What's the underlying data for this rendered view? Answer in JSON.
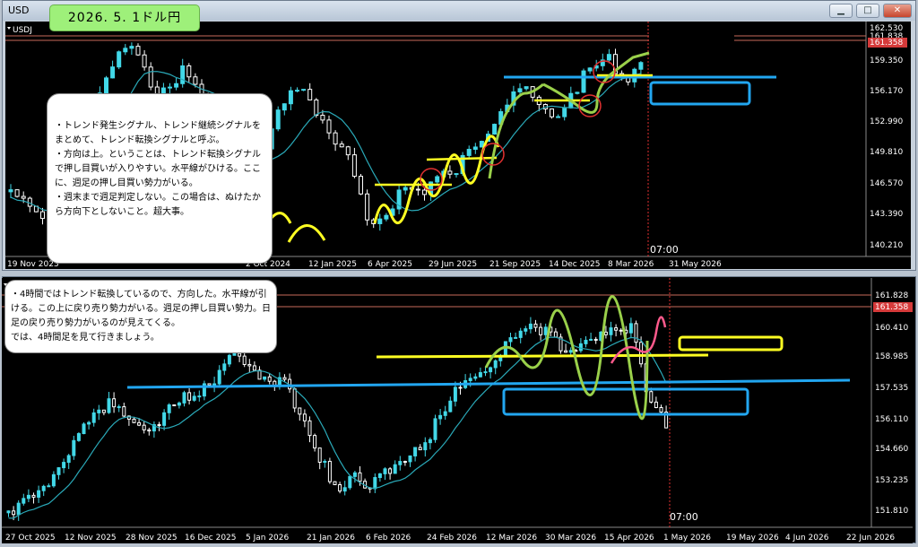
{
  "banner": "2026. 5. 1ドル円",
  "window1": {
    "title": "USD",
    "symbol_label": "USDJ",
    "price_labels": [
      "162.530",
      "161.838",
      "161.358",
      "159.350",
      "156.170",
      "152.990",
      "149.810",
      "146.570",
      "143.390",
      "140.210"
    ],
    "date_labels": [
      "19 Nov 2023",
      "2 Oct 2024",
      "12 Jan 2025",
      "6 Apr 2025",
      "29 Jun 2025",
      "21 Sep 2025",
      "14 Dec 2025",
      "8 Mar 2026",
      "31 May 2026"
    ],
    "time_marker": "07:00",
    "note_lines": [
      "・トレンド発生シグナル、トレンド継続シグナルをまとめて、トレンド転換シグナルと呼ぶ。",
      "・方向は上。ということは、トレンド転換シグナルで押し目買いが入りやすい。水平線がひける。ここに、週足の押し目買い勢力がいる。",
      "・週末まで週足判定しない。この場合は、ぬけたから方向下としないこと。超大事。"
    ]
  },
  "window2": {
    "price_labels": [
      "161.828",
      "161.358",
      "160.410",
      "158.985",
      "157.535",
      "156.110",
      "154.660",
      "153.235",
      "151.810"
    ],
    "date_labels": [
      "27 Oct 2025",
      "12 Nov 2025",
      "28 Nov 2025",
      "16 Dec 2025",
      "5 Jan 2026",
      "21 Jan 2026",
      "6 Feb 2026",
      "24 Feb 2026",
      "12 Mar 2026",
      "30 Mar 2026",
      "15 Apr 2026",
      "1 May 2026",
      "19 May 2026",
      "4 Jun 2026",
      "22 Jun 2026"
    ],
    "time_marker": "07:00",
    "note_lines": [
      "・4時間ではトレンド転換しているので、方向した。水平線が引ける。この上に戻り売り勢力がいる。週足の押し目買い勢力。日足の戻り売り勢力がいるのが見えてくる。",
      "では、4時間足を見て行きましょう。"
    ]
  },
  "colors": {
    "bull": "#42d8e8",
    "bear": "#ffffff",
    "ma": "#2aa9b8",
    "yellow": "#ffff22",
    "blue": "#22a6f0",
    "green": "#9ad04a",
    "red": "#e03030",
    "pink": "#ff5a8c"
  }
}
